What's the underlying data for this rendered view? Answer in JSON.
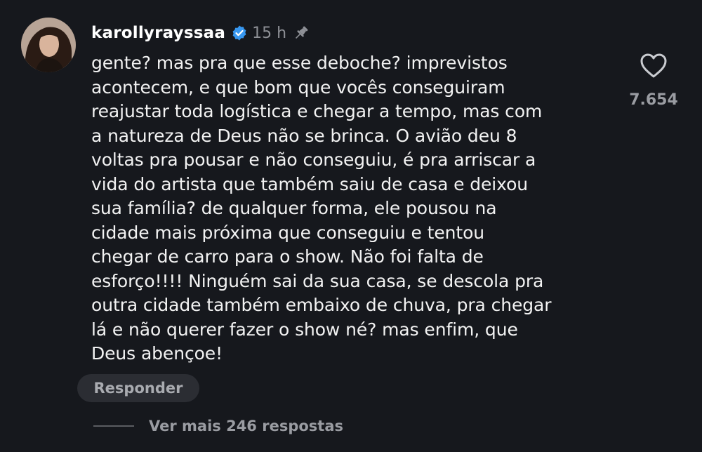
{
  "comment": {
    "username": "karollyrayssaa",
    "time": "15 h",
    "text": "gente? mas pra que esse deboche? imprevistos\nacontecem, e que bom que vocês conseguiram\nreajustar toda logística e chegar a tempo, mas com\na natureza de Deus não se brinca. O avião deu 8\nvoltas pra pousar e não conseguiu, é pra arriscar a\nvida do artista que também saiu de casa e deixou\nsua família? de qualquer forma, ele pousou na\ncidade mais próxima que conseguiu e tentou\nchegar de carro para o show. Não foi falta de\nesforço!!!! Ninguém sai da sua casa, se descola pra\noutra cidade também embaixo de chuva, pra chegar\nlá e não querer fazer o show né? mas enfim, que\nDeus abençoe!",
    "like_count": "7.654",
    "reply_label": "Responder",
    "more_replies_label": "Ver mais 246 respostas"
  },
  "icons": {
    "verified": "verified-badge-icon",
    "pin": "pin-icon",
    "like": "heart-icon"
  },
  "colors": {
    "background": "#16181d",
    "verified_badge": "#3797f0",
    "secondary_text": "#8e9096"
  }
}
